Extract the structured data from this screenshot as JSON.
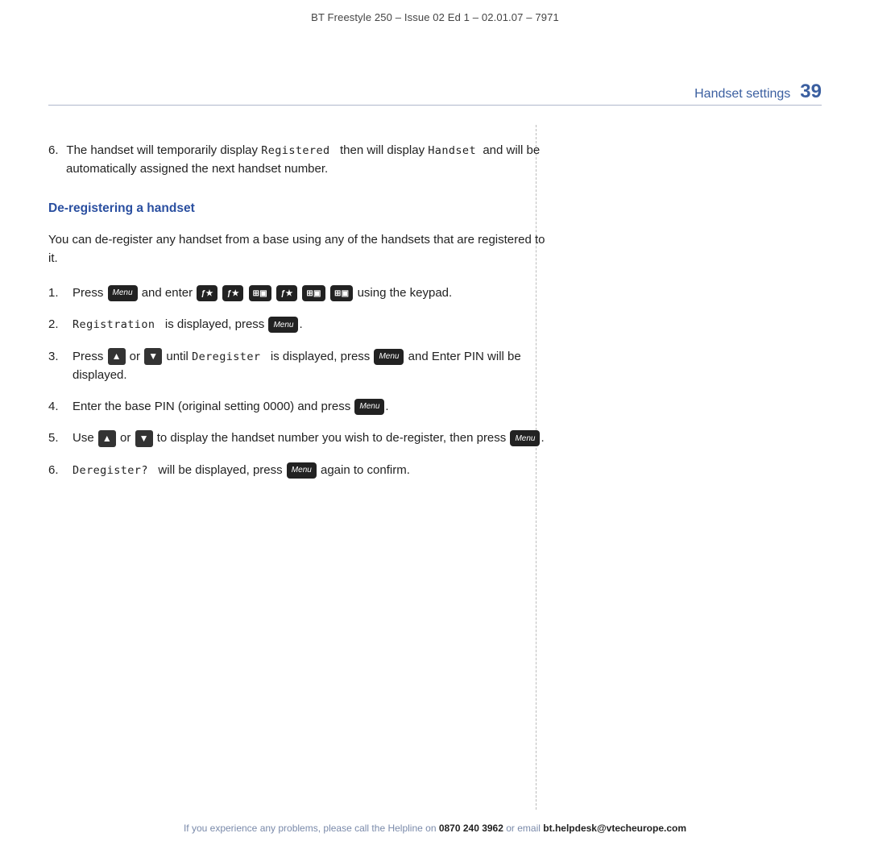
{
  "header": {
    "title": "BT Freestyle 250 – Issue 02 Ed 1 – 02.01.07 – 7971"
  },
  "page": {
    "section": "Handset settings",
    "number": "39"
  },
  "content": {
    "step6_intro": {
      "num": "6.",
      "text": "The handset will temporarily display Registered   then will display Handset  and will be automatically assigned the next handset number."
    },
    "deregister_heading": "De-registering a handset",
    "deregister_intro": "You can de-register any handset from a base using any of the handsets that are registered to it.",
    "steps": [
      {
        "num": "1.",
        "text_before": "Press",
        "key1": "Menu",
        "text_middle": "and enter",
        "keys": [
          "f*",
          "f*",
          "#a",
          "f*",
          "#a",
          "#a"
        ],
        "text_after": "using the keypad."
      },
      {
        "num": "2.",
        "screen": "Registration",
        "text": "is displayed, press",
        "key": "Menu",
        "text_end": "."
      },
      {
        "num": "3.",
        "text_before": "Press",
        "up": true,
        "or_text": "or",
        "down": true,
        "text_middle": "until Deregister   is displayed, press",
        "key": "Menu",
        "text_end": "and Enter PIN will be displayed."
      },
      {
        "num": "4.",
        "text": "Enter the base PIN (original setting 0000) and press",
        "key": "Menu",
        "text_end": "."
      },
      {
        "num": "5.",
        "text_before": "Use",
        "up": true,
        "or_text": "or",
        "down": true,
        "text_after": "to display the handset number you wish to de-register, then press",
        "key": "Menu",
        "text_end": "."
      },
      {
        "num": "6.",
        "screen": "Deregister?",
        "text": "will be displayed, press",
        "key": "Menu",
        "text_end": "again to confirm."
      }
    ]
  },
  "footer": {
    "text_before": "If you experience any problems, please call the Helpline on ",
    "phone": "0870 240 3962",
    "text_middle": " or email ",
    "email": "bt.helpdesk@vtecheurope.com"
  }
}
